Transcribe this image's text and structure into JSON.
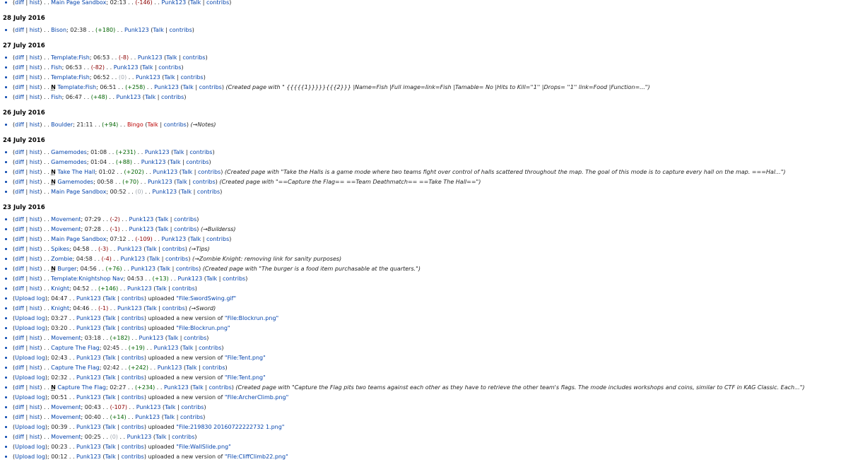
{
  "days": [
    {
      "date": "",
      "entries": [
        {
          "kind": "edit",
          "diff": "diff",
          "hist": "hist",
          "page": "Main Page Sandbox",
          "time": "02:13",
          "size": "(-146)",
          "size_class": "neg",
          "user": "Punk123",
          "talk": "Talk",
          "contribs": "contribs"
        }
      ]
    },
    {
      "date": "28 July 2016",
      "entries": [
        {
          "kind": "edit",
          "diff": "diff",
          "hist": "hist",
          "page": "Bison",
          "time": "02:38",
          "size": "(+180)",
          "size_class": "pos",
          "user": "Punk123",
          "talk": "Talk",
          "contribs": "contribs"
        }
      ]
    },
    {
      "date": "27 July 2016",
      "entries": [
        {
          "kind": "edit",
          "diff": "diff",
          "hist": "hist",
          "page": "Template:Fish",
          "time": "06:53",
          "size": "(-8)",
          "size_class": "neg",
          "user": "Punk123",
          "talk": "Talk",
          "contribs": "contribs"
        },
        {
          "kind": "edit",
          "diff": "diff",
          "hist": "hist",
          "page": "Fish",
          "time": "06:53",
          "size": "(-82)",
          "size_class": "neg",
          "user": "Punk123",
          "talk": "Talk",
          "contribs": "contribs"
        },
        {
          "kind": "edit",
          "diff": "diff",
          "hist": "hist",
          "page": "Template:Fish",
          "time": "06:52",
          "size": "(0)",
          "size_class": "zero",
          "user": "Punk123",
          "talk": "Talk",
          "contribs": "contribs"
        },
        {
          "kind": "edit",
          "diff": "diff",
          "hist": "hist",
          "new": "N",
          "page": "Template:Fish",
          "time": "06:51",
          "size": "(+258)",
          "size_class": "pos",
          "user": "Punk123",
          "talk": "Talk",
          "contribs": "contribs",
          "comment": "(Created page with \" {{{{{1}}}}}{{{2}}} |Name=Fish |Full image=link=Fish |Tamable= No |Hits to Kill=''1'' |Drops= ''1'' link=Food |Function=...\")"
        },
        {
          "kind": "edit",
          "diff": "diff",
          "hist": "hist",
          "page": "Fish",
          "time": "06:47",
          "size": "(+48)",
          "size_class": "pos",
          "user": "Punk123",
          "talk": "Talk",
          "contribs": "contribs"
        }
      ]
    },
    {
      "date": "26 July 2016",
      "entries": [
        {
          "kind": "edit",
          "diff": "diff",
          "hist": "hist",
          "page": "Boulder",
          "time": "21:11",
          "size": "(+94)",
          "size_class": "pos",
          "user": "Bingo",
          "user_red": true,
          "talk": "Talk",
          "contribs": "contribs",
          "comment": "(→Notes)"
        }
      ]
    },
    {
      "date": "24 July 2016",
      "entries": [
        {
          "kind": "edit",
          "diff": "diff",
          "hist": "hist",
          "page": "Gamemodes",
          "time": "01:08",
          "size": "(+231)",
          "size_class": "pos",
          "user": "Punk123",
          "talk": "Talk",
          "contribs": "contribs"
        },
        {
          "kind": "edit",
          "diff": "diff",
          "hist": "hist",
          "page": "Gamemodes",
          "time": "01:04",
          "size": "(+88)",
          "size_class": "pos",
          "user": "Punk123",
          "talk": "Talk",
          "contribs": "contribs"
        },
        {
          "kind": "edit",
          "diff": "diff",
          "hist": "hist",
          "new": "N",
          "page": "Take The Hall",
          "time": "01:02",
          "size": "(+202)",
          "size_class": "pos",
          "user": "Punk123",
          "talk": "Talk",
          "contribs": "contribs",
          "comment": "(Created page with \"Take the Halls is a game mode where two teams fight over control of halls scattered throughout the map. The goal of this mode is to capture every hall on the map. ===Hal...\")"
        },
        {
          "kind": "edit",
          "diff": "diff",
          "hist": "hist",
          "new": "N",
          "page": "Gamemodes",
          "time": "00:58",
          "size": "(+70)",
          "size_class": "pos",
          "user": "Punk123",
          "talk": "Talk",
          "contribs": "contribs",
          "comment": "(Created page with \"==Capture the Flag== ==Team Deathmatch== ==Take The Hall==\")"
        },
        {
          "kind": "edit",
          "diff": "diff",
          "hist": "hist",
          "page": "Main Page Sandbox",
          "time": "00:52",
          "size": "(0)",
          "size_class": "zero",
          "user": "Punk123",
          "talk": "Talk",
          "contribs": "contribs"
        }
      ]
    },
    {
      "date": "23 July 2016",
      "entries": [
        {
          "kind": "edit",
          "diff": "diff",
          "hist": "hist",
          "page": "Movement",
          "time": "07:29",
          "size": "(-2)",
          "size_class": "neg",
          "user": "Punk123",
          "talk": "Talk",
          "contribs": "contribs"
        },
        {
          "kind": "edit",
          "diff": "diff",
          "hist": "hist",
          "page": "Movement",
          "time": "07:28",
          "size": "(-1)",
          "size_class": "neg",
          "user": "Punk123",
          "talk": "Talk",
          "contribs": "contribs",
          "comment": "(→Builderss)"
        },
        {
          "kind": "edit",
          "diff": "diff",
          "hist": "hist",
          "page": "Main Page Sandbox",
          "time": "07:12",
          "size": "(-109)",
          "size_class": "neg",
          "user": "Punk123",
          "talk": "Talk",
          "contribs": "contribs"
        },
        {
          "kind": "edit",
          "diff": "diff",
          "hist": "hist",
          "page": "Spikes",
          "time": "04:58",
          "size": "(-3)",
          "size_class": "neg",
          "user": "Punk123",
          "talk": "Talk",
          "contribs": "contribs",
          "comment": "(→Tips)"
        },
        {
          "kind": "edit",
          "diff": "diff",
          "hist": "hist",
          "page": "Zombie",
          "time": "04:58",
          "size": "(-4)",
          "size_class": "neg",
          "user": "Punk123",
          "talk": "Talk",
          "contribs": "contribs",
          "comment": "(→Zombie Knight: removing link for sanity purposes)"
        },
        {
          "kind": "edit",
          "diff": "diff",
          "hist": "hist",
          "new": "N",
          "page": "Burger",
          "time": "04:56",
          "size": "(+76)",
          "size_class": "pos",
          "user": "Punk123",
          "talk": "Talk",
          "contribs": "contribs",
          "comment": "(Created page with \"The burger is a food item purchasable at the quarters.\")"
        },
        {
          "kind": "edit",
          "diff": "diff",
          "hist": "hist",
          "page": "Template:Knightshop Nav",
          "time": "04:53",
          "size": "(+13)",
          "size_class": "pos",
          "user": "Punk123",
          "talk": "Talk",
          "contribs": "contribs"
        },
        {
          "kind": "edit",
          "diff": "diff",
          "hist": "hist",
          "page": "Knight",
          "time": "04:52",
          "size": "(+146)",
          "size_class": "pos",
          "user": "Punk123",
          "talk": "Talk",
          "contribs": "contribs"
        },
        {
          "kind": "log",
          "log": "Upload log",
          "time": "04:47",
          "user": "Punk123",
          "talk": "Talk",
          "contribs": "contribs",
          "action": "uploaded",
          "file": "\"File:SwordSwing.gif\""
        },
        {
          "kind": "edit",
          "diff": "diff",
          "hist": "hist",
          "page": "Knight",
          "time": "04:46",
          "size": "(-1)",
          "size_class": "neg",
          "user": "Punk123",
          "talk": "Talk",
          "contribs": "contribs",
          "comment": "(→Sword)"
        },
        {
          "kind": "log",
          "log": "Upload log",
          "time": "03:27",
          "user": "Punk123",
          "talk": "Talk",
          "contribs": "contribs",
          "action": "uploaded a new version of",
          "file": "\"File:Blockrun.png\""
        },
        {
          "kind": "log",
          "log": "Upload log",
          "time": "03:20",
          "user": "Punk123",
          "talk": "Talk",
          "contribs": "contribs",
          "action": "uploaded",
          "file": "\"File:Blockrun.png\""
        },
        {
          "kind": "edit",
          "diff": "diff",
          "hist": "hist",
          "page": "Movement",
          "time": "03:18",
          "size": "(+182)",
          "size_class": "pos",
          "user": "Punk123",
          "talk": "Talk",
          "contribs": "contribs"
        },
        {
          "kind": "edit",
          "diff": "diff",
          "hist": "hist",
          "page": "Capture The Flag",
          "time": "02:45",
          "size": "(+19)",
          "size_class": "pos",
          "user": "Punk123",
          "talk": "Talk",
          "contribs": "contribs"
        },
        {
          "kind": "log",
          "log": "Upload log",
          "time": "02:43",
          "user": "Punk123",
          "talk": "Talk",
          "contribs": "contribs",
          "action": "uploaded a new version of",
          "file": "\"File:Tent.png\""
        },
        {
          "kind": "edit",
          "diff": "diff",
          "hist": "hist",
          "page": "Capture The Flag",
          "time": "02:42",
          "size": "(+242)",
          "size_class": "pos",
          "user": "Punk123",
          "talk": "Talk",
          "contribs": "contribs"
        },
        {
          "kind": "log",
          "log": "Upload log",
          "time": "02:32",
          "user": "Punk123",
          "talk": "Talk",
          "contribs": "contribs",
          "action": "uploaded a new version of",
          "file": "\"File:Tent.png\""
        },
        {
          "kind": "edit",
          "diff": "diff",
          "hist": "hist",
          "new": "N",
          "page": "Capture The Flag",
          "time": "02:27",
          "size": "(+234)",
          "size_class": "pos",
          "user": "Punk123",
          "talk": "Talk",
          "contribs": "contribs",
          "comment": "(Created page with \"Capture the Flag pits two teams against each other as they have to retrieve the other team's flags. The mode includes workshops and coins, similar to CTF in KAG Classic. Each...\")"
        },
        {
          "kind": "log",
          "log": "Upload log",
          "time": "00:51",
          "user": "Punk123",
          "talk": "Talk",
          "contribs": "contribs",
          "action": "uploaded a new version of",
          "file": "\"File:ArcherClimb.png\""
        },
        {
          "kind": "edit",
          "diff": "diff",
          "hist": "hist",
          "page": "Movement",
          "time": "00:43",
          "size": "(-107)",
          "size_class": "neg",
          "user": "Punk123",
          "talk": "Talk",
          "contribs": "contribs"
        },
        {
          "kind": "edit",
          "diff": "diff",
          "hist": "hist",
          "page": "Movement",
          "time": "00:40",
          "size": "(+14)",
          "size_class": "pos",
          "user": "Punk123",
          "talk": "Talk",
          "contribs": "contribs"
        },
        {
          "kind": "log",
          "log": "Upload log",
          "time": "00:39",
          "user": "Punk123",
          "talk": "Talk",
          "contribs": "contribs",
          "action": "uploaded",
          "file": "\"File:219830 20160722222732 1.png\""
        },
        {
          "kind": "edit",
          "diff": "diff",
          "hist": "hist",
          "page": "Movement",
          "time": "00:25",
          "size": "(0)",
          "size_class": "zero",
          "user": "Punk123",
          "talk": "Talk",
          "contribs": "contribs"
        },
        {
          "kind": "log",
          "log": "Upload log",
          "time": "00:23",
          "user": "Punk123",
          "talk": "Talk",
          "contribs": "contribs",
          "action": "uploaded",
          "file": "\"File:WallSlide.png\""
        },
        {
          "kind": "log",
          "log": "Upload log",
          "time": "00:12",
          "user": "Punk123",
          "talk": "Talk",
          "contribs": "contribs",
          "action": "uploaded a new version of",
          "file": "\"File:CliffClimb22.png\""
        }
      ]
    }
  ]
}
